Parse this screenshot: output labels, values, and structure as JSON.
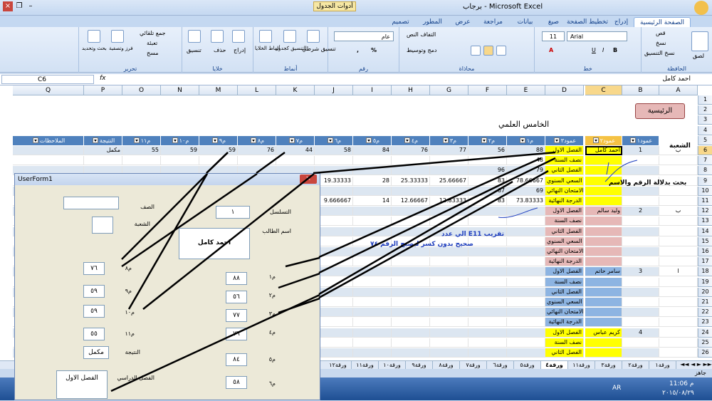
{
  "window": {
    "title": "برجاب - Microsoft Excel",
    "context_tab": "أدوات الجدول"
  },
  "tabs": [
    "الصفحة الرئيسية",
    "إدراج",
    "تخطيط الصفحة",
    "صيغ",
    "بيانات",
    "مراجعة",
    "عرض",
    "المطور",
    "تصميم"
  ],
  "ribbon": {
    "clipboard": {
      "label": "الحافظة",
      "paste": "لصق",
      "cut": "قص",
      "copy": "نسخ",
      "format_painter": "نسخ التنسيق"
    },
    "font": {
      "label": "خط",
      "font_name": "Arial",
      "font_size": "11"
    },
    "alignment": {
      "label": "محاذاة",
      "wrap": "التفاف النص",
      "merge": "دمج وتوسيط"
    },
    "number": {
      "label": "رقم",
      "format": "عام"
    },
    "styles": {
      "label": "أنماط",
      "conditional": "تنسيق شرطي",
      "as_table": "التنسيق كجدول",
      "cell_styles": "أنماط الخلايا"
    },
    "cells": {
      "label": "خلايا",
      "insert": "إدراج",
      "delete": "حذف",
      "format": "تنسيق"
    },
    "editing": {
      "label": "تحرير",
      "autosum": "جمع تلقائي",
      "fill": "تعبئة",
      "clear": "مسح",
      "sort": "فرز وتصفية",
      "find": "بحث وتحديد"
    }
  },
  "formula_bar": {
    "name_box": "C6",
    "fx": "fx",
    "content": "احمد كامل"
  },
  "columns": [
    "A",
    "B",
    "C",
    "D",
    "E",
    "F",
    "G",
    "H",
    "I",
    "J",
    "K",
    "L",
    "M",
    "N",
    "O",
    "P",
    "Q"
  ],
  "rows": [
    "1",
    "2",
    "3",
    "4",
    "5",
    "6",
    "7",
    "8",
    "9",
    "10",
    "11",
    "12",
    "13",
    "14",
    "15",
    "16",
    "17",
    "18",
    "19",
    "20",
    "21",
    "22",
    "23",
    "24",
    "25",
    "26"
  ],
  "sheet": {
    "home_button": "الرئيسية",
    "class_title": "الخامس العلمي",
    "branch_header": "الشعبة",
    "headers": {
      "b": "عمود١",
      "c": "عمود٢",
      "d": "عمود٣",
      "e": "م١",
      "f": "م٢",
      "g": "م٣",
      "h": "م٤",
      "i": "م٥",
      "j": "م٦",
      "k": "م٧",
      "l": "م٨",
      "m": "م٩",
      "n": "م١٠",
      "o": "م١١",
      "p": "النتيجة",
      "q": "الملاحظات"
    },
    "row6": {
      "a": "ب",
      "b": "1",
      "c": "احمد كامل",
      "d": "الفصل الاول",
      "e": "88",
      "f": "56",
      "g": "77",
      "h": "76",
      "i": "84",
      "j": "58",
      "k": "44",
      "l": "76",
      "m": "59",
      "n": "59",
      "o": "55",
      "p": "مكمل"
    },
    "row7": {
      "d": "نصف السنة",
      "e": "48"
    },
    "row8": {
      "d": "الفصل الثاني",
      "e": "79",
      "f": "96"
    },
    "row9": {
      "d": "السعي السنوي",
      "e": "78.66667",
      "f": "83",
      "g": "25.66667",
      "h": "25.33333",
      "i": "28",
      "j": "19.33333"
    },
    "row10": {
      "d": "الامتحان النهائي",
      "e": "69",
      "f": "67"
    },
    "row11": {
      "d": "الدرجة النهائية",
      "e": "73.83333",
      "f": "83",
      "g": "12.83333",
      "h": "12.66667",
      "i": "14",
      "j": "9.666667"
    },
    "row12": {
      "a": "ب",
      "b": "2",
      "c": "وليد سالم",
      "d": "الفصل الاول"
    },
    "row18": {
      "a": "ا",
      "b": "3",
      "c": "سامر حاتم",
      "d": "الفصل الاول"
    },
    "row24": {
      "b": "4",
      "c": "كريم عباس",
      "d": "الفصل الاول"
    },
    "annotation1": "بحث بدلالة الرقم والاسم",
    "annotation2a": "الي عدد E11  تقريب",
    "annotation2b": "صحيح  بدون كسر   ليصبح الرقم  ٧٤"
  },
  "sheet_tabs": [
    "ورقة١",
    "ورقة٢",
    "ورقة٣",
    "ورقة١١",
    "ورقة٤",
    "ورقة٥",
    "ورقة٦",
    "ورقة٧",
    "ورقة٨",
    "ورقة٩",
    "ورقة١٠",
    "ورقة١١",
    "ورقة١٢"
  ],
  "status": {
    "ready": "جاهز"
  },
  "taskbar": {
    "lang": "AR",
    "time": "11:06 م",
    "date": "٢٠١٥/٠٨/٢٩"
  },
  "userform": {
    "title": "UserForm1",
    "serial_label": "التسلسل",
    "serial_value": "١",
    "name_label": "اسم الطالب",
    "name_value": "احمد كامل",
    "class_label": "الصف",
    "branch_label": "الشعبة",
    "m1_label": "م١",
    "m1_value": "٨٨",
    "m2_label": "م٢",
    "m2_value": "٥٦",
    "m3_label": "م٣",
    "m3_value": "٧٧",
    "m4_label": "م٤",
    "m4_value": "٧٦",
    "m5_label": "م٥",
    "m5_value": "٨٤",
    "m6_label": "م٦",
    "m6_value": "٥٨",
    "m8_label": "م٨",
    "m8_value": "٧٦",
    "m9_label": "م٩",
    "m9_value": "٥٩",
    "m10_label": "م١٠",
    "m10_value": "٥٩",
    "m11_label": "م١١",
    "m11_value": "٥٥",
    "result_label": "النتيجة",
    "result_value": "مكمل",
    "semester_label": "الفصل الدراسي",
    "semester_value": "الفصل الاول"
  }
}
